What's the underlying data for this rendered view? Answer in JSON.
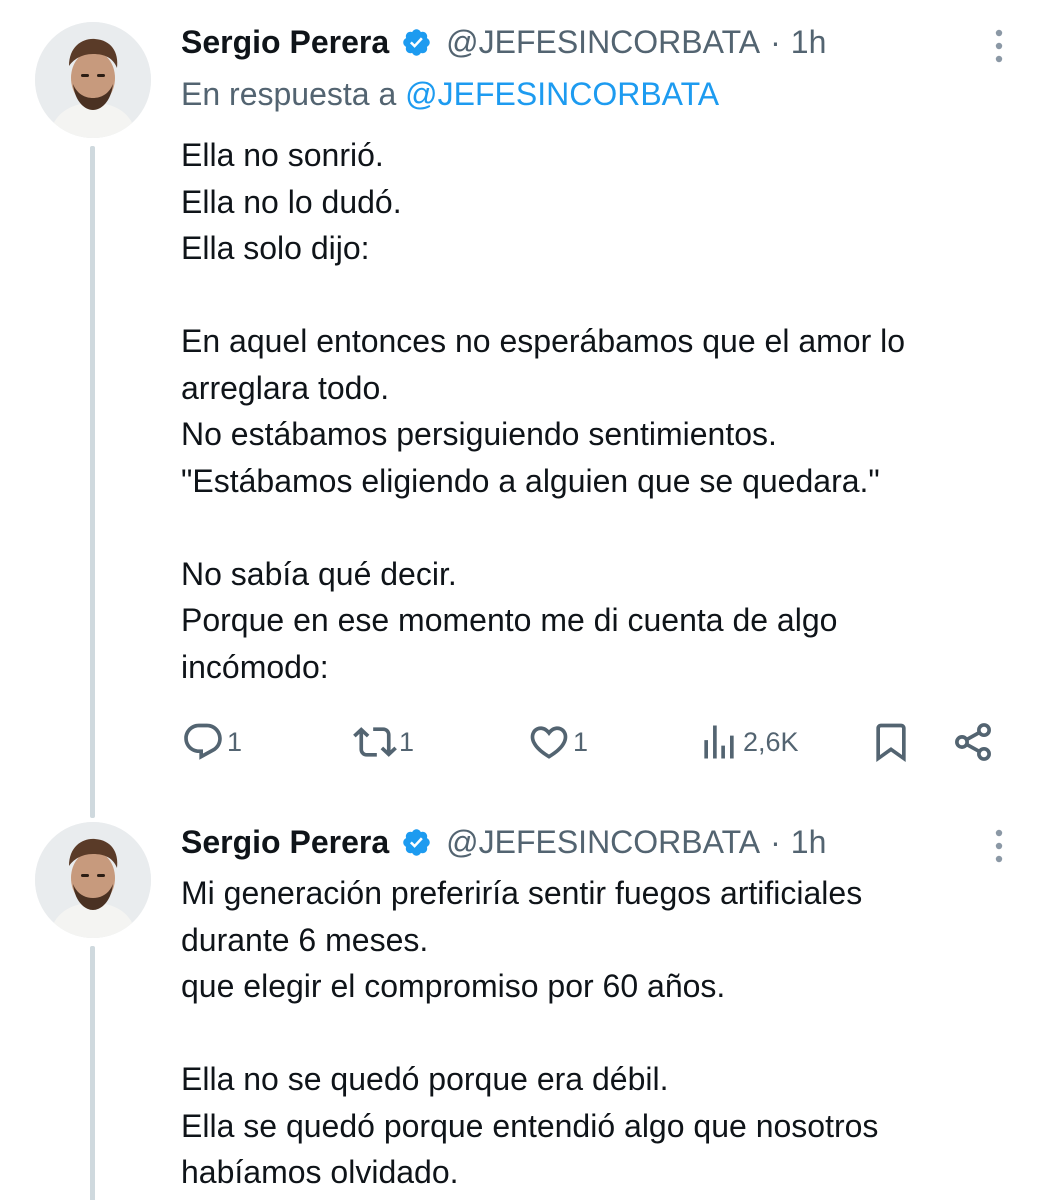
{
  "tweets": [
    {
      "author_name": "Sergio Perera",
      "handle": "@JEFESINCORBATA",
      "separator": "·",
      "time": "1h",
      "reply_prefix": "En respuesta a",
      "reply_mention": "@JEFESINCORBATA",
      "lines": [
        "Ella no sonrió.",
        "Ella no lo dudó.",
        "Ella solo dijo:",
        "",
        "En aquel entonces no esperábamos que el amor lo",
        "arreglara todo.",
        "No estábamos persiguiendo sentimientos.",
        "\"Estábamos eligiendo a alguien que se quedara.\"",
        "",
        "No sabía qué decir.",
        "Porque en ese momento me di cuenta de algo",
        "incómodo:"
      ],
      "actions": {
        "reply_count": "1",
        "retweet_count": "1",
        "like_count": "1",
        "views_count": "2,6K"
      }
    },
    {
      "author_name": "Sergio Perera",
      "handle": "@JEFESINCORBATA",
      "separator": "·",
      "time": "1h",
      "lines": [
        "Mi generación preferiría sentir fuegos artificiales",
        "durante 6 meses.",
        "que elegir el compromiso por 60 años.",
        "",
        "Ella no se quedó porque era débil.",
        "Ella se quedó porque entendió algo que nosotros",
        "habíamos olvidado."
      ]
    }
  ],
  "icons": {
    "verified": "verified-badge-icon",
    "more": "more-vertical-icon",
    "reply": "reply-icon",
    "retweet": "retweet-icon",
    "like": "heart-icon",
    "views": "views-icon",
    "bookmark": "bookmark-icon",
    "share": "share-icon"
  },
  "colors": {
    "text": "#0f1419",
    "secondary": "#536471",
    "accent": "#1d9bf0",
    "thread_line": "#cfd9de"
  }
}
